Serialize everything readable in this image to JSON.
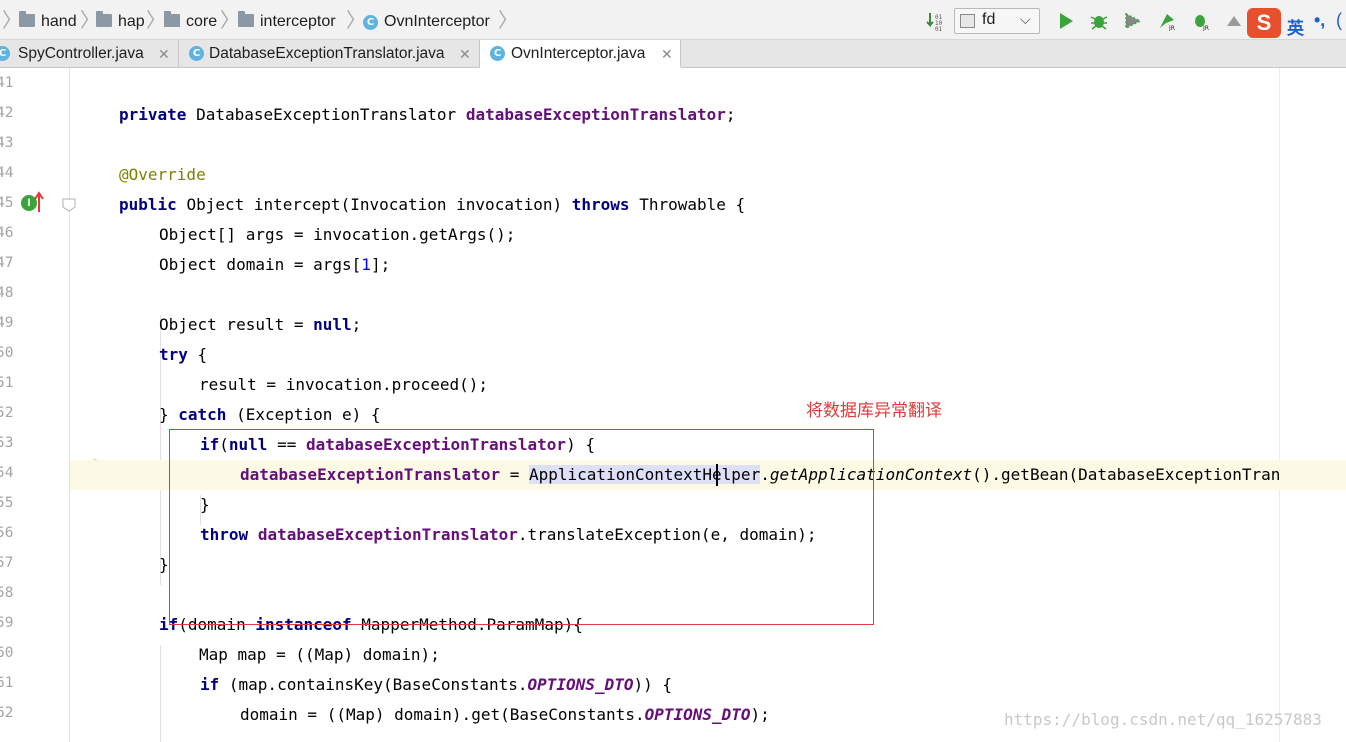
{
  "breadcrumb": {
    "items": [
      "hand",
      "hap",
      "core",
      "interceptor",
      "OvnInterceptor"
    ]
  },
  "toolbar": {
    "run_config": "fd",
    "ime_label": "英"
  },
  "tabs": [
    {
      "label": "SpyController.java",
      "active": false
    },
    {
      "label": "DatabaseExceptionTranslator.java",
      "active": false
    },
    {
      "label": "OvnInterceptor.java",
      "active": true
    }
  ],
  "gutter": {
    "line_numbers": [
      "41",
      "42",
      "43",
      "44",
      "45",
      "46",
      "47",
      "48",
      "49",
      "50",
      "51",
      "52",
      "53",
      "54",
      "55",
      "56",
      "57",
      "58",
      "59",
      "60",
      "61",
      "62"
    ]
  },
  "code": {
    "l42": {
      "kw": "private",
      "type": "DatabaseExceptionTranslator",
      "field": "databaseExceptionTranslator",
      "end": ";"
    },
    "l44": {
      "annotation": "@Override"
    },
    "l45": {
      "kw1": "public",
      "sig": "Object intercept(Invocation invocation)",
      "kw2": "throws",
      "rest": "Throwable {"
    },
    "l46": {
      "text": "Object[] args = invocation.getArgs();"
    },
    "l47": {
      "pre": "Object domain = args[",
      "num": "1",
      "post": "];"
    },
    "l49": {
      "pre": "Object result = ",
      "kw": "null",
      "post": ";"
    },
    "l50": {
      "kw": "try",
      "post": " {"
    },
    "l51": {
      "text": "result = invocation.proceed();"
    },
    "l52": {
      "pre": "} ",
      "kw": "catch",
      "post": " (Exception e) {"
    },
    "l53": {
      "kw1": "if",
      "p1": "(",
      "kw2": "null",
      "p2": " == ",
      "field": "databaseExceptionTranslator",
      "p3": ") {"
    },
    "l54": {
      "field": "databaseExceptionTranslator",
      "p1": " = ",
      "sel1": "ApplicationCont",
      "sel2": "extHelper",
      "p2": ".",
      "ital": "getApplicationContext",
      "p3": "().getBean(DatabaseExceptionTran"
    },
    "l55": {
      "text": "}"
    },
    "l56": {
      "kw": "throw",
      "p1": " ",
      "field": "databaseExceptionTranslator",
      "p2": ".translateException(e, domain);"
    },
    "l57": {
      "text": "}"
    },
    "l59": {
      "kw1": "if",
      "p1": "(domain ",
      "kw2": "instanceof",
      "p2": " MapperMethod.ParamMap){"
    },
    "l60": {
      "text": "Map map = ((Map) domain);"
    },
    "l61": {
      "kw": "if",
      "p1": " (map.containsKey(BaseConstants.",
      "static": "OPTIONS_DTO",
      "p2": ")) {"
    },
    "l62": {
      "p1": "domain = ((Map) domain).get(BaseConstants.",
      "static": "OPTIONS_DTO",
      "p2": ");"
    }
  },
  "annotation_note": "将数据库异常翻译",
  "watermark": "https://blog.csdn.net/qq_16257883",
  "colors": {
    "keyword": "#000080",
    "field": "#660e7a",
    "annotation": "#808000",
    "number": "#0000ff",
    "highlight_box": "#e23a3a",
    "current_line": "#fcfae5"
  }
}
